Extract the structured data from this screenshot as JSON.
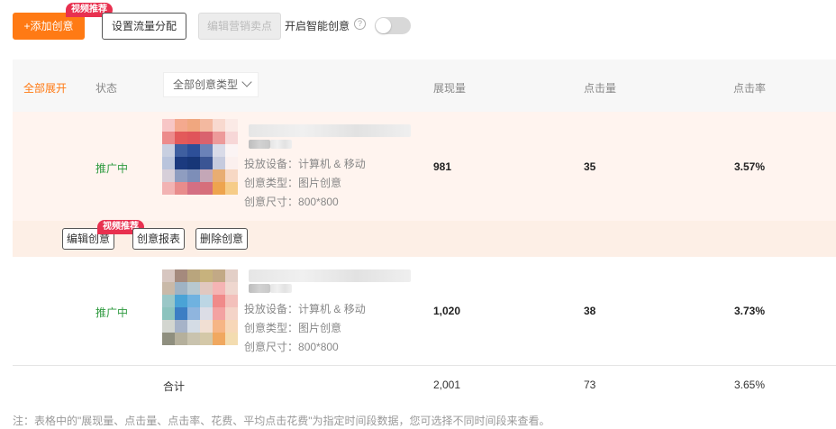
{
  "toolbar": {
    "add_label": "+添加创意",
    "add_badge": "视频推荐",
    "traffic_label": "设置流量分配",
    "edit_sell_label": "编辑营销卖点",
    "smart_label": "开启智能创意",
    "help_glyph": "?",
    "smart_enabled": false
  },
  "table": {
    "headers": {
      "expand": "全部展开",
      "status": "状态",
      "type_select": "全部创意类型",
      "impressions": "展现量",
      "clicks": "点击量",
      "ctr": "点击率"
    },
    "rows": [
      {
        "status": "推广中",
        "device_label": "投放设备：",
        "device": "计算机 & 移动",
        "type_label": "创意类型：",
        "type": "图片创意",
        "size_label": "创意尺寸：",
        "size": "800*800",
        "impressions": "981",
        "clicks": "35",
        "ctr": "3.57%",
        "thumb_colors": [
          "#f7c6c6",
          "#f4a98e",
          "#f0a77f",
          "#f3b9a0",
          "#f8d9cf",
          "#fbeae6",
          "#ec8b8b",
          "#e35a5a",
          "#e0555a",
          "#d9626e",
          "#ed9a9a",
          "#f7d7d7",
          "#c8cfe0",
          "#3f5fa0",
          "#2d4f98",
          "#6b82b8",
          "#d9dbe8",
          "#fbf4f4",
          "#b9c4dc",
          "#1b3a7f",
          "#173677",
          "#3b5594",
          "#c6cbde",
          "#fbf0ee",
          "#d7cfd9",
          "#8f9dc0",
          "#7d8eb8",
          "#c4a7b7",
          "#e8ad72",
          "#f7d8c4",
          "#f2b3b3",
          "#e88c8c",
          "#d46f83",
          "#d66f7b",
          "#eea44e",
          "#f6cc88"
        ]
      },
      {
        "status": "推广中",
        "device_label": "投放设备：",
        "device": "计算机 & 移动",
        "type_label": "创意类型：",
        "type": "图片创意",
        "size_label": "创意尺寸：",
        "size": "800*800",
        "impressions": "1,020",
        "clicks": "38",
        "ctr": "3.73%",
        "thumb_colors": [
          "#d7c6c0",
          "#a58a7d",
          "#b9a57d",
          "#c7b27d",
          "#c2a986",
          "#e3cfc7",
          "#c9b9a8",
          "#9fb3c4",
          "#b7c8d0",
          "#e1c8c0",
          "#f5b4b4",
          "#efd7cf",
          "#9ac7c7",
          "#4aa3d6",
          "#6fb2e0",
          "#bcd6e4",
          "#f08a8a",
          "#f3c0bb",
          "#8cc3be",
          "#3c7ec4",
          "#8fb5de",
          "#dcdde6",
          "#f3a2a2",
          "#f4d4c8",
          "#d3d6d0",
          "#a6b3c8",
          "#d4dce5",
          "#f1dfd3",
          "#f6b585",
          "#f7d7b8",
          "#8f8f7f",
          "#b5b09c",
          "#c9c3ae",
          "#d4c8a8",
          "#f0a860",
          "#f3dcb0"
        ]
      }
    ],
    "actions": {
      "edit": "编辑创意",
      "edit_badge": "视频推荐",
      "report": "创意报表",
      "delete": "删除创意"
    },
    "totals": {
      "label": "合计",
      "impressions": "2,001",
      "clicks": "73",
      "ctr": "3.65%"
    }
  },
  "note": "注：表格中的\"展现量、点击量、点击率、花费、平均点击花费\"为指定时间段数据，您可选择不同时间段来查看。",
  "colors": {
    "accent": "#ff7a14",
    "status_green": "#2e9a3f",
    "badge_red": "#e8304f",
    "row_highlight": "#fff4ef"
  }
}
